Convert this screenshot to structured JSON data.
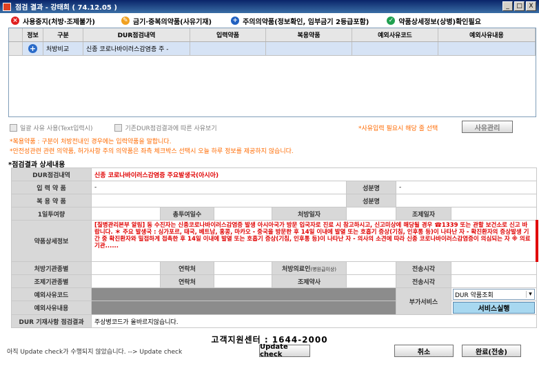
{
  "window": {
    "title": "점검 결과 - 강태희 ( 74.12.05 )",
    "min": "_",
    "max": "□",
    "close": "X"
  },
  "legend": [
    {
      "label": "사용중지(처방·조제불가)",
      "color": "#e02020",
      "icon": "x-circle-icon",
      "glyph": "×"
    },
    {
      "label": "금기·중복의약품(사유기재)",
      "color": "#f0a020",
      "icon": "pencil-circle-icon",
      "glyph": "✎"
    },
    {
      "label": "주의의약품(정보확인, 임부금기 2등급포함)",
      "color": "#2060c0",
      "icon": "plus-circle-icon",
      "glyph": "+"
    },
    {
      "label": "약품상세정보(상병)확인필요",
      "color": "#20a050",
      "icon": "check-circle-icon",
      "glyph": "✓"
    }
  ],
  "grid": {
    "headers": [
      "정보",
      "구분",
      "DUR점검내역",
      "입력약품",
      "복용약품",
      "예외사유코드",
      "예외사유내용"
    ],
    "rows": [
      {
        "info_icon": "plus-circle-icon",
        "category": "처방비교",
        "dur": "신종 코로나바이러스감염증 주 -",
        "input": "",
        "taking": "",
        "code": "",
        "reason": ""
      }
    ]
  },
  "options": {
    "bulk_reason": "일괄 사유 사용(Text입력시)",
    "prev_reason": "기존DUR점검결과에 따른 사유보기",
    "reason_note": "*사유입력 필요시 해당 줄 선택",
    "manage_button": "사유관리"
  },
  "notes": [
    "*복용약품 : 구분이 처방전내인 경우에는 입력약품을 말합니다.",
    "*안전성관련 관련 의약품, 허가사항 주의 의약품은 좌측 체크박스 선택시 오늘 하루 정보를 제공하지 않습니다."
  ],
  "section_title": "*점검결과 상세내용",
  "detail": {
    "dur_label": "DUR점검내역",
    "dur_value": "신종 코로나바이러스감염증 주요발생국(아시아)",
    "input_label": "입 력 약 품",
    "input_value": "-",
    "ingredient_label": "성분명",
    "ingredient_value": "-",
    "taking_label": "복 용 약 품",
    "taking_value": "",
    "ingredient2_label": "성분명",
    "ingredient2_value": "",
    "dose_label": "1일투여량",
    "total_days_label": "총투여일수",
    "rx_date_label": "처방일자",
    "dispense_date_label": "조제일자",
    "info_label": "약품상세정보",
    "info_value": "[질병관리본부 알림] 동 수진자는 신종코로나바이러스감염증 발생 아시아국가 방문 입국자로 진료 시 참고하시고, 신고미상에 해당될 경우 ☎1339 또는 관할 보건소로 신고 바랍니다. ＊ 주요 발생국 : 싱가포르, 태국, 베트남, 홍콩, 마카오 - 중국을 방문한 후 14일 이내에 발열 또는 호흡기 증상(기침, 인후통 등)이 나타난 자 - 확진환자의 증상발생 기간 중 확진환자와 밀접하게 접촉한 후 14일 이내에 발열 또는 호흡기 증상(기침, 인후통 등)이 나타난 자 - 의사의 소견에 따라 신종 코로나바이러스감염증이 의심되는 자 ※ 의료기관......",
    "rx_inst_label": "처방기관종별",
    "contact_label": "연락처",
    "rx_doctor_label": "처방의료인",
    "rx_doctor_sub": "(병원급이상)",
    "send_time_label": "전송시각",
    "disp_inst_label": "조제기관종별",
    "contact2_label": "연락처",
    "disp_doctor_label": "조제약사",
    "send_time2_label": "전송시각",
    "exc_code_label": "예외사유코드",
    "addon_label": "부가서비스",
    "addon_select": "DUR 약품조회",
    "addon_button": "서비스실행",
    "exc_reason_label": "예외사유내용",
    "dur_record_label": "DUR 기재사항 점검결과",
    "dur_record_value": "주상병코드가 올바르지않습니다."
  },
  "footer": {
    "center_label": "고객지원센터  :  1644-2000",
    "status": "아직 Update check가 수행되지 않았습니다.  --> Update check",
    "update_button": "Update check",
    "cancel_button": "취소",
    "complete_button": "완료(전송)"
  }
}
